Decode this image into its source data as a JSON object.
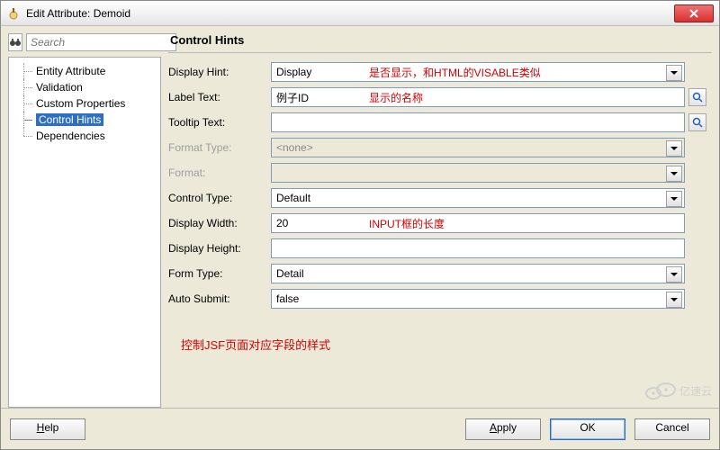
{
  "window": {
    "title": "Edit Attribute: Demoid"
  },
  "search": {
    "placeholder": "Search"
  },
  "nav": {
    "items": [
      {
        "label": "Entity Attribute"
      },
      {
        "label": "Validation"
      },
      {
        "label": "Custom Properties"
      },
      {
        "label": "Control Hints",
        "selected": true
      },
      {
        "label": "Dependencies"
      }
    ]
  },
  "panel": {
    "heading": "Control Hints"
  },
  "form": {
    "display_hint": {
      "label": "Display Hint:",
      "value": "Display",
      "type": "dropdown"
    },
    "label_text": {
      "label": "Label Text:",
      "value": "例子ID",
      "type": "text_lookup"
    },
    "tooltip_text": {
      "label": "Tooltip Text:",
      "value": "",
      "type": "text_lookup"
    },
    "format_type": {
      "label": "Format Type:",
      "value": "<none>",
      "type": "dropdown",
      "disabled": true
    },
    "format": {
      "label": "Format:",
      "value": "",
      "type": "dropdown",
      "disabled": true
    },
    "control_type": {
      "label": "Control Type:",
      "value": "Default",
      "type": "dropdown"
    },
    "display_width": {
      "label": "Display Width:",
      "value": "20",
      "type": "text"
    },
    "display_height": {
      "label": "Display Height:",
      "value": "",
      "type": "text"
    },
    "form_type": {
      "label": "Form Type:",
      "value": "Detail",
      "type": "dropdown"
    },
    "auto_submit": {
      "label": "Auto Submit:",
      "value": "false",
      "type": "dropdown"
    }
  },
  "annotations": {
    "display_hint": "是否显示，和HTML的VISABLE类似",
    "label_text": "显示的名称",
    "display_width": "INPUT框的长度",
    "summary": "控制JSF页面对应字段的样式"
  },
  "footer": {
    "help": "Help",
    "apply": "Apply",
    "ok": "OK",
    "cancel": "Cancel"
  },
  "watermark": "亿速云"
}
